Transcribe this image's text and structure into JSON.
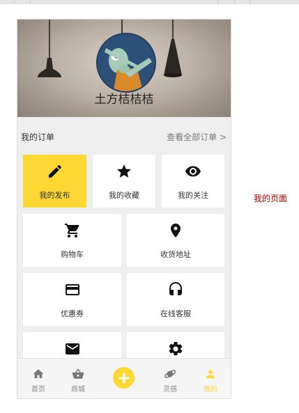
{
  "colors": {
    "accent": "#fdd835",
    "side_note": "#b00000"
  },
  "profile": {
    "username": "土方桔桔桔",
    "avatar": "avatar-dabbing-character"
  },
  "orders": {
    "title": "我的订单",
    "view_all": "查看全部订单 >"
  },
  "tiles": [
    {
      "label": "我的发布",
      "icon": "pencil-icon",
      "active": true
    },
    {
      "label": "我的收藏",
      "icon": "star-icon",
      "active": false
    },
    {
      "label": "我的关注",
      "icon": "eye-icon",
      "active": false
    },
    {
      "label": "购物车",
      "icon": "cart-icon",
      "active": false
    },
    {
      "label": "收货地址",
      "icon": "location-pin-icon",
      "active": false
    },
    {
      "label": "优惠券",
      "icon": "credit-card-icon",
      "active": false
    },
    {
      "label": "在线客服",
      "icon": "headset-icon",
      "active": false
    },
    {
      "label": "",
      "icon": "mail-icon",
      "active": false
    },
    {
      "label": "",
      "icon": "gear-icon",
      "active": false
    }
  ],
  "tabbar": {
    "home": "首页",
    "shop": "商城",
    "inspiration": "灵感",
    "mine": "我的",
    "active": "mine"
  },
  "side_note": "我的页面"
}
